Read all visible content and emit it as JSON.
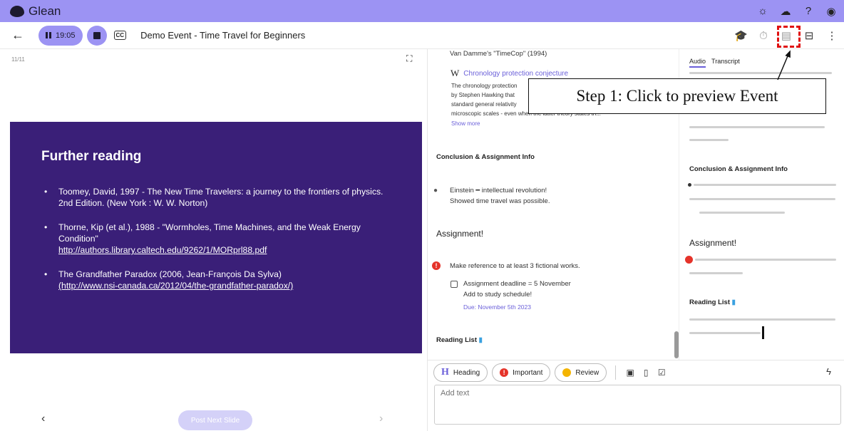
{
  "app": {
    "name": "Glean",
    "icons": [
      "sun-icon",
      "cloud-upload-icon",
      "help-icon",
      "account-icon"
    ]
  },
  "toolbar": {
    "back_icon": "←",
    "timer": "19:05",
    "cc_label": "CC",
    "title": "Demo Event - Time Travel for Beginners",
    "right_icons": [
      "graduation-cap-icon",
      "stopwatch-icon",
      "preview-event-icon",
      "layout-icon",
      "more-icon"
    ]
  },
  "slide": {
    "counter": "11/11",
    "heading": "Further reading",
    "items": [
      {
        "text": "Toomey, David, 1997 - The New Time Travelers: a journey to the frontiers of physics. 2nd Edition. (New York : W. W. Norton)",
        "link": ""
      },
      {
        "text": "Thorne, Kip (et al.), 1988 - \"Wormholes, Time Machines, and the Weak Energy Condition\"",
        "link": "http://authors.library.caltech.edu/9262/1/MORprl88.pdf"
      },
      {
        "text": "The Grandfather Paradox (2006, Jean-François Da Sylva)",
        "link": "(http://www.nsi-canada.ca/2012/04/the-grandfather-paradox/)"
      }
    ],
    "post_next_label": "Post Next Slide",
    "prev": "‹",
    "next": "›"
  },
  "notes": {
    "cop": "Van Damme's \"TimeCop\" (1994)",
    "wiki_title": "Chronology protection conjecture",
    "wiki_lines": [
      "The chronology protection",
      "by Stephen Hawking that",
      "standard general relativity",
      "microscopic scales - even"
    ],
    "wiki_tail": "when the latter theory states th...",
    "show_more": "Show more",
    "conclusion_heading": "Conclusion & Assignment Info",
    "conclusion_line1": "Einstein ━ intellectual revolution!",
    "conclusion_line2": "Showed time travel was possible.",
    "assignment_heading": "Assignment!",
    "assignment_warn": "Make reference to at least 3 fictional works.",
    "deadline": "Assignment deadline = 5 November",
    "study": "Add to study schedule!",
    "due": "Due: November 5th 2023",
    "reading_list": "Reading List"
  },
  "preview": {
    "tabs": [
      "Audio",
      "Transcript"
    ],
    "conclusion_heading": "Conclusion & Assignment Info",
    "assignment_heading": "Assignment!",
    "reading_list": "Reading List"
  },
  "callout": {
    "text": "Step 1: Click to preview Event"
  },
  "composer": {
    "chips": [
      "Heading",
      "Important",
      "Review"
    ],
    "placeholder": "Add text"
  },
  "colors": {
    "accent": "#9c93f3",
    "slide_bg": "#3a1f78",
    "warn": "#e5332a",
    "highlight": "#e01010"
  }
}
